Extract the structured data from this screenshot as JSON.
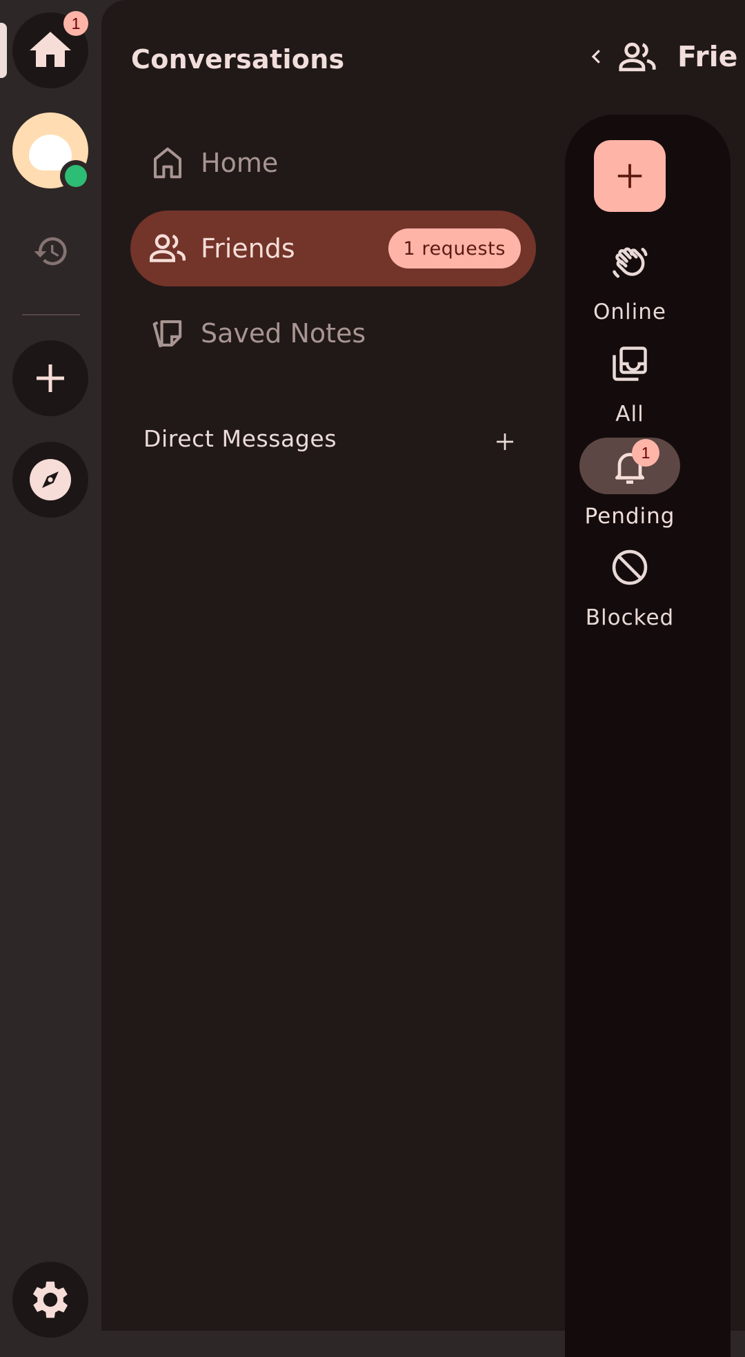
{
  "rail": {
    "home_badge": "1",
    "items": [
      "home-icon",
      "avatar",
      "history-icon",
      "add-icon",
      "compass-icon",
      "settings-icon"
    ],
    "status_color": "#2ebd74"
  },
  "sidebar": {
    "title": "Conversations",
    "nav": [
      {
        "label": "Home",
        "icon": "home-outline-icon"
      },
      {
        "label": "Friends",
        "icon": "people-icon",
        "chip": "1 requests"
      },
      {
        "label": "Saved Notes",
        "icon": "notes-icon"
      }
    ],
    "dm_header": "Direct Messages"
  },
  "header": {
    "title": "Frie"
  },
  "friends_rail": {
    "items": [
      {
        "label": "Online",
        "icon": "waving-hand-icon"
      },
      {
        "label": "All",
        "icon": "inbox-stack-icon"
      },
      {
        "label": "Pending",
        "icon": "bell-icon",
        "badge": "1"
      },
      {
        "label": "Blocked",
        "icon": "block-icon"
      }
    ]
  },
  "colors": {
    "accent": "#ffb4a8",
    "active_nav": "#73342a",
    "background": "#211918"
  }
}
